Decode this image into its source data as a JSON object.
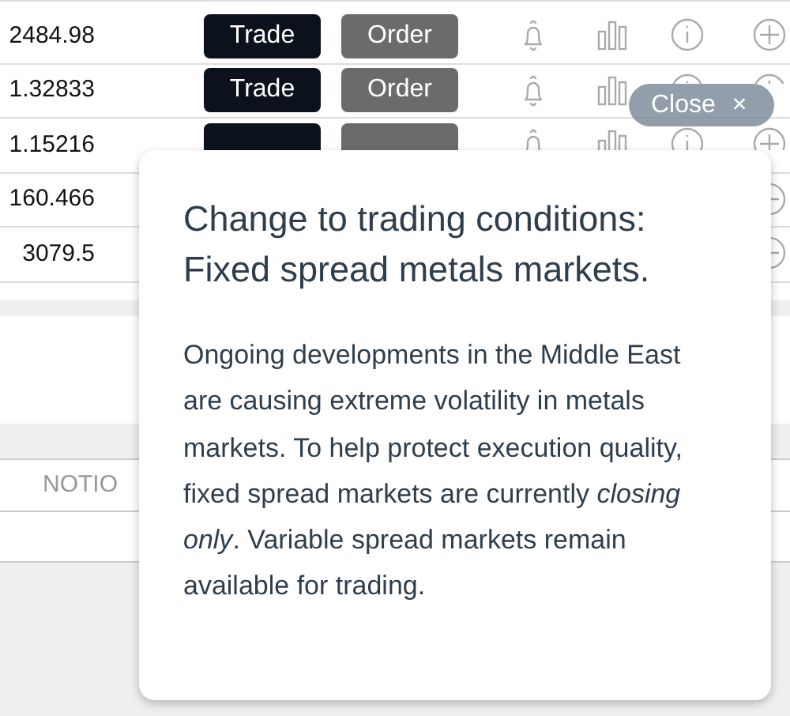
{
  "market_rows": [
    {
      "price": "2484.98",
      "buttons": [
        {
          "kind": "trade",
          "label": "Trade"
        },
        {
          "kind": "order",
          "label": "Order"
        }
      ]
    },
    {
      "price": "1.32833",
      "buttons": [
        {
          "kind": "trade",
          "label": "Trade"
        },
        {
          "kind": "order",
          "label": "Order"
        }
      ]
    },
    {
      "price": "1.15216",
      "buttons": [
        {
          "kind": "trade"
        },
        {
          "kind": "order"
        }
      ]
    },
    {
      "price": "160.466",
      "buttons": []
    },
    {
      "price": "3079.5",
      "buttons": []
    }
  ],
  "positions_header": {
    "columns": [
      "NOTIO"
    ]
  },
  "close_button": {
    "label": "Close",
    "icon": "×"
  },
  "notice": {
    "title": "Change to trading conditions: Fixed spread metals markets.",
    "body": "Ongoing developments in the Middle East are causing extreme volatility in metals markets. To help protect execution quality, fixed spread markets are currently *closing only*. Variable spread markets remain available for trading."
  }
}
